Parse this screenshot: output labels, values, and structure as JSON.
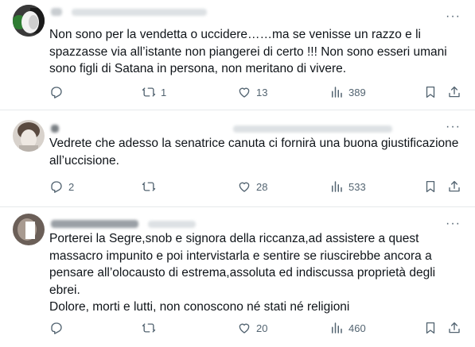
{
  "tweets": [
    {
      "text": "Non sono per la vendetta o uccidere……ma se venisse un razzo e li\nspazzasse via all’istante non piangerei di certo !!! Non sono esseri umani\nsono figli di Satana in persona, non meritano di vivere.",
      "replies": "",
      "retweets": "1",
      "likes": "13",
      "views": "389"
    },
    {
      "text": "Vedrete che adesso la senatrice canuta ci fornirà una buona giustificazione\nall’uccisione.",
      "replies": "2",
      "retweets": "",
      "likes": "28",
      "views": "533"
    },
    {
      "text": "Porterei la Segre,snob e signora della riccanza,ad assistere a quest\nmassacro impunito e poi intervistarla e sentire se riuscirebbe ancora a\npensare all’olocausto di estrema,assoluta ed indiscussa proprietà degli\nebrei.\nDolore, morti e lutti, non conoscono né stati né religioni",
      "replies": "",
      "retweets": "",
      "likes": "20",
      "views": "460"
    }
  ],
  "icons": {
    "reply": "reply-icon",
    "retweet": "retweet-icon",
    "like": "heart-icon",
    "views": "views-chart-icon",
    "bookmark": "bookmark-icon",
    "share": "share-icon",
    "more": "more-options-icon"
  },
  "colors": {
    "text": "#0f1419",
    "secondary": "#536471",
    "divider": "#e6e9eb"
  }
}
